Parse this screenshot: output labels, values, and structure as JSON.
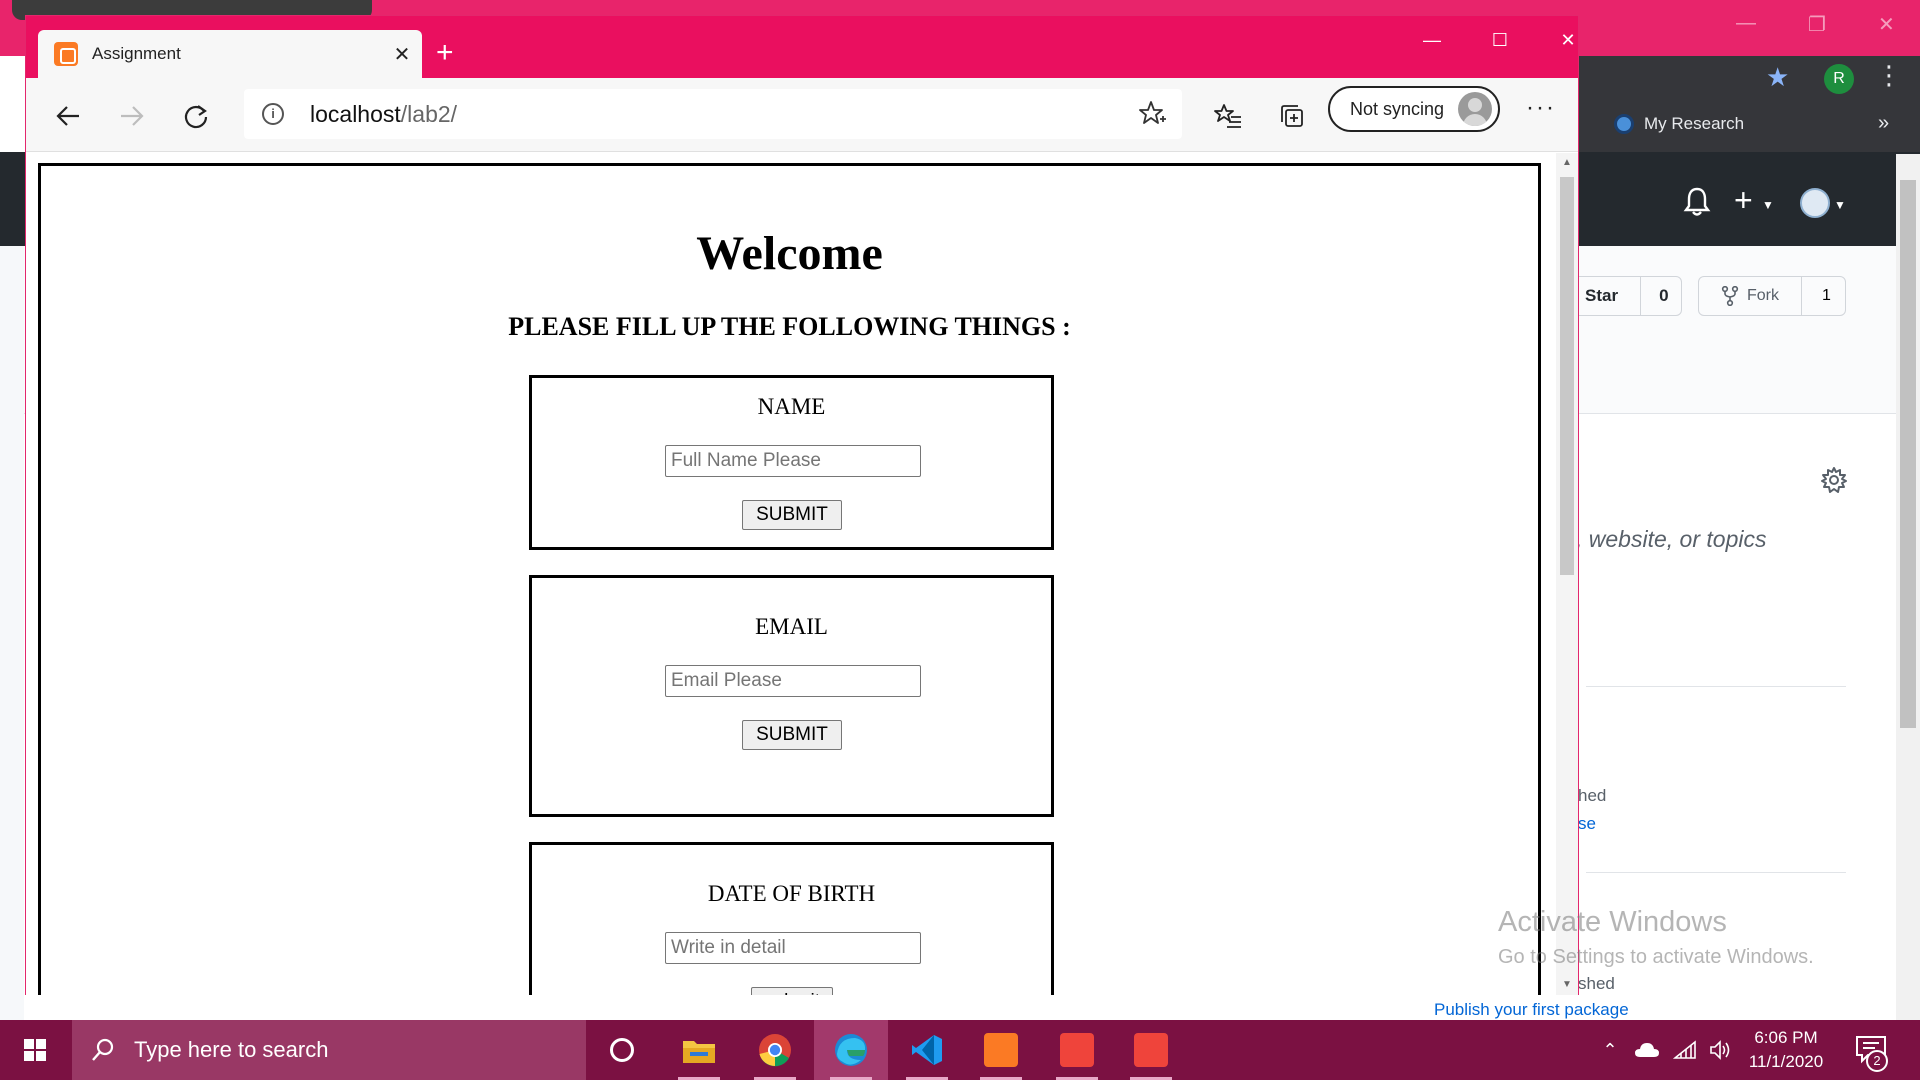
{
  "edge": {
    "tab_title": "Assignment",
    "address_host": "localhost",
    "address_path": "/lab2/",
    "sync_label": "Not syncing",
    "more_label": "···"
  },
  "page": {
    "heading": "Welcome",
    "subtitle": "PLEASE FILL UP THE FOLLOWING THINGS :",
    "forms": [
      {
        "label": "NAME",
        "placeholder": "Full Name Please",
        "button": "SUBMIT"
      },
      {
        "label": "EMAIL",
        "placeholder": "Email Please",
        "button": "SUBMIT"
      },
      {
        "label": "DATE OF BIRTH",
        "placeholder": "Write in detail",
        "button": "submit"
      }
    ]
  },
  "background": {
    "bookmark": "My Research",
    "star_label": "Star",
    "star_count": "0",
    "fork_label": "Fork",
    "fork_count": "1",
    "about_fragment": ", website, or topics",
    "frag_hed": "hed",
    "frag_se": "se",
    "frag_shed": "shed",
    "publish_link": "Publish your first package",
    "avatar_letter": "R",
    "activate_title": "Activate Windows",
    "activate_sub": "Go to Settings to activate Windows."
  },
  "taskbar": {
    "search_placeholder": "Type here to search",
    "time": "6:06 PM",
    "date": "11/1/2020",
    "notification_count": "2"
  },
  "colors": {
    "edge_accent": "#ea0f5f",
    "taskbar": "#7b1142",
    "github_header": "#24292e"
  }
}
